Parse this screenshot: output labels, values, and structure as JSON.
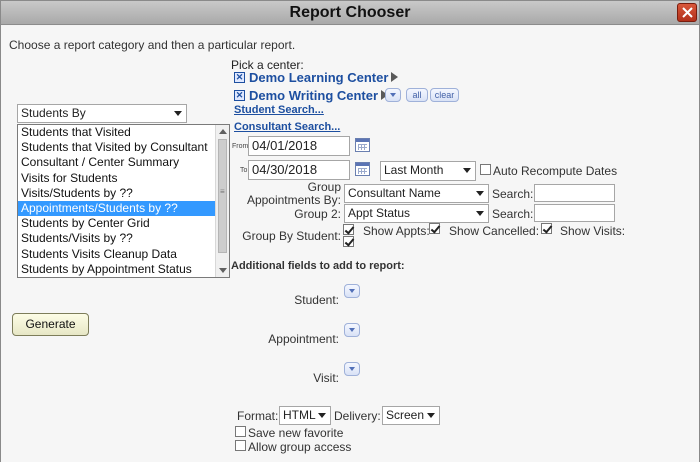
{
  "window": {
    "title": "Report Chooser"
  },
  "intro": "Choose a report category and then a particular report.",
  "category_select": {
    "value": "Students By"
  },
  "report_list": {
    "items": [
      "Students that Visited",
      "Students that Visited by Consultant",
      "Consultant / Center Summary",
      "Visits for Students",
      "Visits/Students by ??",
      "Appointments/Students by ??",
      "Students by Center Grid",
      "Students/Visits by ??",
      "Students Visits Cleanup Data",
      "Students by Appointment Status"
    ],
    "selected_index": 5
  },
  "generate_label": "Generate",
  "centers": {
    "pick_label": "Pick a center:",
    "selected": [
      "Demo Learning Center",
      "Demo Writing Center"
    ],
    "all_label": "all",
    "clear_label": "clear",
    "student_search": "Student Search...",
    "consultant_search": "Consultant Search..."
  },
  "dates": {
    "from_label": "From:",
    "from_value": "04/01/2018",
    "to_label": "To:",
    "to_value": "04/30/2018",
    "range_value": "Last Month",
    "auto_recompute_label": "Auto Recompute Dates"
  },
  "grouping": {
    "group1_label_line1": "Group",
    "group1_label_line2": "Appointments By:",
    "group1_value": "Consultant Name",
    "group2_label": "Group 2:",
    "group2_value": "Appt Status",
    "search_label": "Search:",
    "group_by_student_label": "Group By Student:",
    "show_appts_label": "Show Appts:",
    "show_cancelled_label": "Show Cancelled:",
    "show_visits_label": "Show Visits:"
  },
  "additional": {
    "heading": "Additional fields to add to report:",
    "student_label": "Student:",
    "appointment_label": "Appointment:",
    "visit_label": "Visit:"
  },
  "output": {
    "format_label": "Format:",
    "format_value": "HTML",
    "delivery_label": "Delivery:",
    "delivery_value": "Screen",
    "save_favorite_label": "Save new favorite",
    "allow_group_label": "Allow group access"
  },
  "colors": {
    "link_blue": "#1d4fa0",
    "selection_blue": "#3399ff",
    "close_red": "#c0392b"
  }
}
